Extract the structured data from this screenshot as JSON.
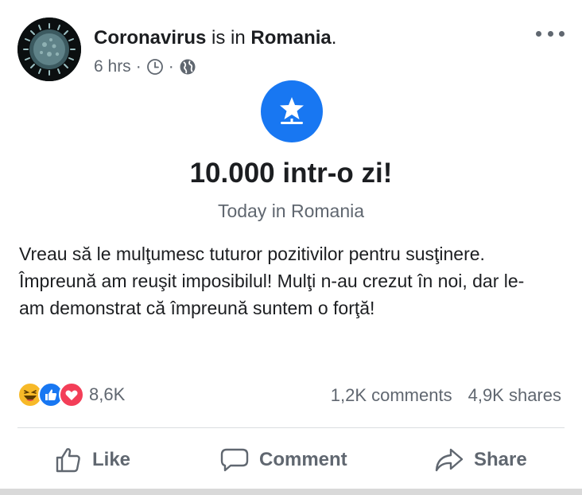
{
  "header": {
    "author": "Coronavirus",
    "connector": "is in",
    "place": "Romania",
    "place_suffix": ".",
    "time": "6 hrs",
    "separator": "·",
    "clock_icon": "clock-icon",
    "audience_icon": "globe-icon",
    "more_icon": "more-horizontal-icon"
  },
  "event": {
    "icon": "star-milestone-icon",
    "title": "10.000 intr-o zi!",
    "subtitle": "Today in Romania",
    "accent_color": "#1877f2"
  },
  "post": {
    "text": "Vreau să le mulţumesc tuturor pozitivilor pentru susţinere. Împreună am reuşit imposibilul! Mulţi n-au crezut în noi, dar le-am demonstrat că împreună suntem o forţă!"
  },
  "stats": {
    "reactions": [
      "haha",
      "like",
      "love"
    ],
    "reaction_count": "8,6K",
    "comments": "1,2K comments",
    "shares": "4,9K shares"
  },
  "actions": {
    "like": "Like",
    "comment": "Comment",
    "share": "Share"
  }
}
